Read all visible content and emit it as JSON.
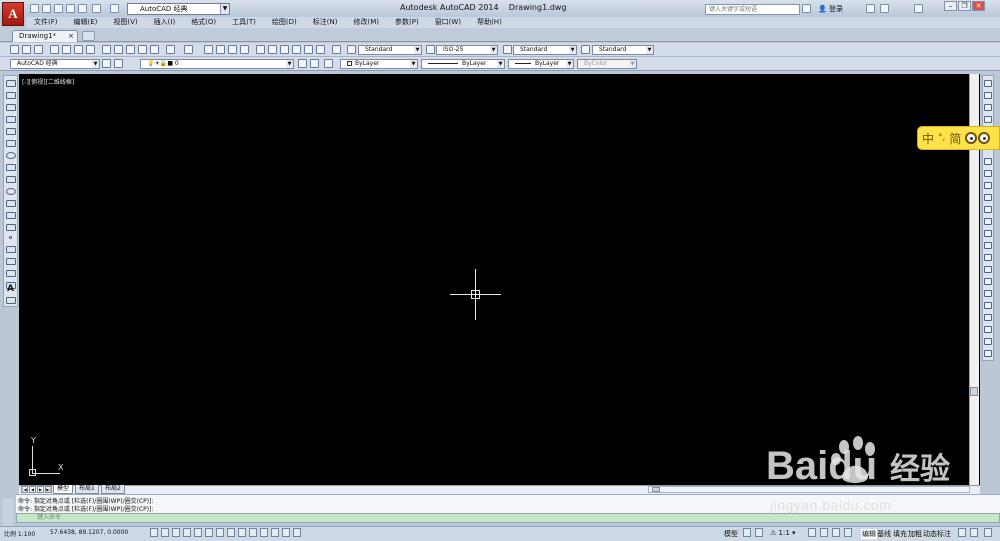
{
  "app": {
    "logo_letter": "A",
    "title": "Autodesk AutoCAD 2014",
    "filename": "Drawing1.dwg",
    "workspace": "AutoCAD 经典",
    "search_placeholder": "键入关键字或短语",
    "login": "登录"
  },
  "menu": [
    "文件(F)",
    "编辑(E)",
    "视图(V)",
    "插入(I)",
    "格式(O)",
    "工具(T)",
    "绘图(D)",
    "标注(N)",
    "修改(M)",
    "参数(P)",
    "窗口(W)",
    "帮助(H)"
  ],
  "document_tab": {
    "label": "Drawing1*",
    "close": "×"
  },
  "toolbar1": {
    "text_style": "Standard",
    "dim_style": "ISO-25",
    "table_style": "Standard",
    "multileader_style": "Standard"
  },
  "toolbar2": {
    "workspace": "AutoCAD 经典",
    "layer": "0",
    "color": "ByLayer",
    "linetype": "ByLayer",
    "lineweight": "ByLayer",
    "plotstyle": "ByColor"
  },
  "viewport": {
    "label": "[-][俯视][二维线框]"
  },
  "ucs": {
    "x": "X",
    "y": "Y"
  },
  "layout_tabs": [
    "模型",
    "布局1",
    "布局2"
  ],
  "command": {
    "history": [
      "命令: 指定对角点或 [栏选(F)/圈围(WP)/圈交(CP)]:",
      "命令: 指定对角点或 [栏选(F)/圈围(WP)/圈交(CP)]:"
    ],
    "input_placeholder": "键入命令"
  },
  "status": {
    "scale": "比例 1:100",
    "coords": "57.6438,  89.1207,  0.0000",
    "model": "模型",
    "annotation_scale": "1:1",
    "right_items": [
      "编辑",
      "基线",
      "填充",
      "加粗",
      "动态标注"
    ]
  },
  "ime": {
    "lang": "中",
    "mode": "简"
  },
  "watermark": {
    "brand": "Baidu",
    "brand_cn": "经验",
    "url": "jingyan.baidu.com"
  }
}
